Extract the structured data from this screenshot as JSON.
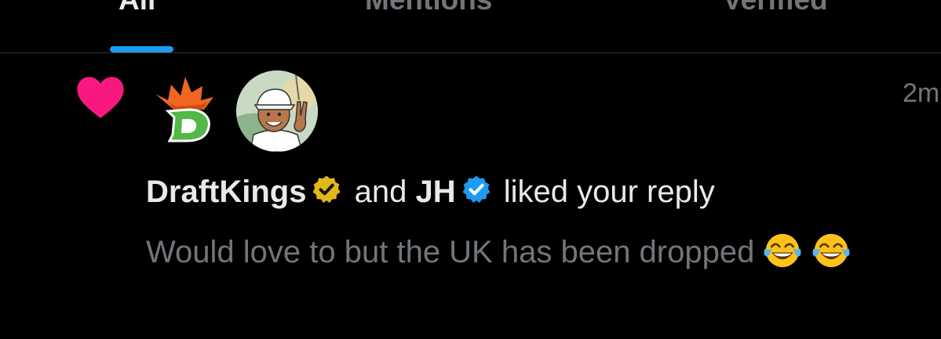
{
  "tabs": [
    {
      "label": "All",
      "active": true
    },
    {
      "label": "Mentions",
      "active": false
    },
    {
      "label": "Verified",
      "active": false
    }
  ],
  "colors": {
    "background": "#000000",
    "accent": "#1d9bf0",
    "like": "#f91880",
    "text_primary": "#e7e9ea",
    "text_secondary": "#71767b",
    "gold_badge": "#e2b719",
    "blue_badge": "#1d9bf0"
  },
  "notification": {
    "icon": "heart-icon",
    "timestamp": "2m",
    "user1": {
      "name": "DraftKings",
      "badge": "gold-verified-badge-icon",
      "avatar": "draftkings-logo"
    },
    "connector": "and",
    "user2": {
      "name": "JH",
      "badge": "blue-verified-badge-icon",
      "avatar": "golfer-cartoon-avatar"
    },
    "action": "liked your reply",
    "reply_text": "Would love to but the UK has been dropped",
    "reply_emojis": [
      "face-with-tears-of-joy",
      "face-with-tears-of-joy"
    ]
  }
}
